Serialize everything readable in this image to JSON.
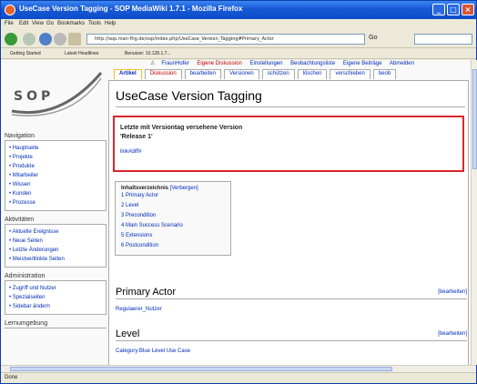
{
  "browser": {
    "title": "UseCase Version Tagging - SOP MediaWiki 1.7.1 - Mozilla Firefox",
    "menu": [
      "File",
      "Edit",
      "View",
      "Go",
      "Bookmarks",
      "Tools",
      "Help"
    ],
    "url": "http://sop.man-fhg.de/sop/index.php/UseCase_Version_Tagging#Primary_Actor",
    "go_label": "Go",
    "bookmarks": [
      "Getting Started",
      "Latest Headlines",
      "Benutzer: 10.128.1.7..."
    ],
    "status": "Done"
  },
  "logo": {
    "text": "SOP"
  },
  "toplinks": [
    {
      "label": "FraunHofer",
      "red": false
    },
    {
      "label": "Eigene Diskussion",
      "red": true
    },
    {
      "label": "Einstellungen",
      "red": false
    },
    {
      "label": "Beobachtungsliste",
      "red": false
    },
    {
      "label": "Eigene Beiträge",
      "red": false
    },
    {
      "label": "Abmelden",
      "red": false
    }
  ],
  "tabs": [
    {
      "label": "Artikel",
      "selected": true
    },
    {
      "label": "Diskussion",
      "red": true
    },
    {
      "label": "bearbeiten"
    },
    {
      "label": "Versionen"
    },
    {
      "label": "schützen"
    },
    {
      "label": "löschen"
    },
    {
      "label": "verschieben"
    },
    {
      "label": "beob"
    }
  ],
  "sidebar": {
    "navigation": {
      "title": "Navigation",
      "items": [
        "Hauptseite",
        "Projekte",
        "Produkte",
        "Mitarbeiter",
        "Wissen",
        "Kunden",
        "Prozesse"
      ]
    },
    "activities": {
      "title": "Aktivitäten",
      "items": [
        "Aktuelle Ereignisse",
        "Neue Seiten",
        "Letzte Änderungen",
        "Meistvertlinkte Seiten"
      ]
    },
    "administration": {
      "title": "Administration",
      "items": [
        "Zugriff und Nutzer",
        "Spezialseiten",
        "Sidebar ändern"
      ]
    },
    "learning": {
      "title": "Lernumgebung"
    }
  },
  "page": {
    "title": "UseCase Version Tagging",
    "version_box": {
      "heading": "Letzte mit Versiontag versehene Version",
      "version": "'Release 1'",
      "link": "link#diff#"
    },
    "toc": {
      "title": "Inhaltsverzeichnis",
      "toggle": "[Verbergen]",
      "items": [
        "1 Primary Actor",
        "2 Level",
        "3 Precondition",
        "4 Main Success Scenario",
        "5 Extensions",
        "6 Postcondition"
      ]
    },
    "sections": [
      {
        "heading": "Primary Actor",
        "edit": "[bearbeiten]",
        "content": "Regulaerer_Nutzer"
      },
      {
        "heading": "Level",
        "edit": "[bearbeiten]",
        "content": "Category:Blue Level Use Case"
      }
    ]
  }
}
